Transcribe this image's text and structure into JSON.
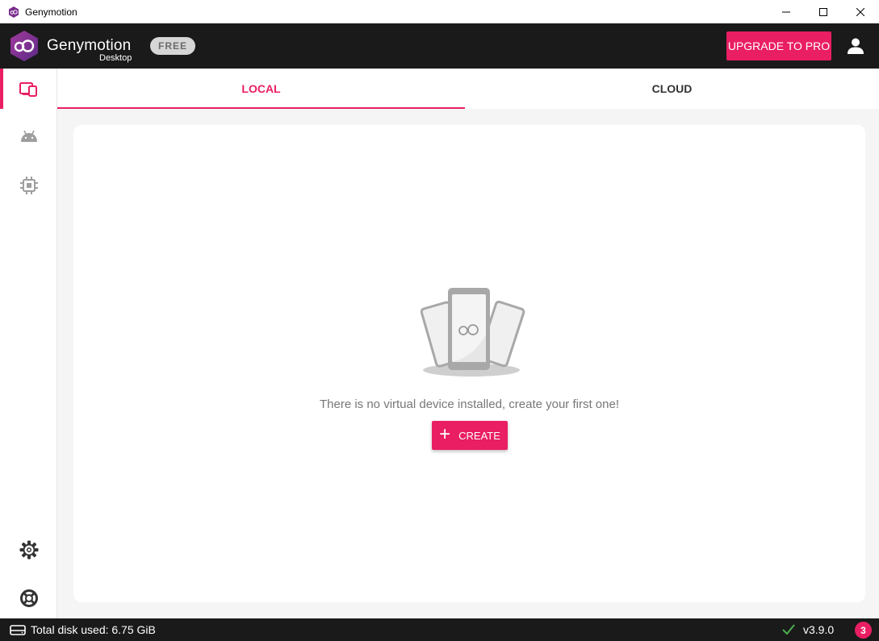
{
  "window": {
    "title": "Genymotion"
  },
  "header": {
    "brand": "Genymotion",
    "brand_sub": "Desktop",
    "plan_badge": "FREE",
    "upgrade_label": "UPGRADE TO PRO"
  },
  "tabs": [
    {
      "label": "LOCAL",
      "active": true
    },
    {
      "label": "CLOUD",
      "active": false
    }
  ],
  "sidebar": {
    "items": [
      {
        "icon": "devices-icon",
        "active": true
      },
      {
        "icon": "android-icon",
        "active": false
      },
      {
        "icon": "chip-icon",
        "active": false
      }
    ],
    "bottom_items": [
      {
        "icon": "gear-icon"
      },
      {
        "icon": "lifebuoy-icon"
      }
    ]
  },
  "main": {
    "empty_message": "There is no virtual device installed, create your first one!",
    "create_label": "CREATE",
    "illustration_icon": "phones-illustration-icon"
  },
  "statusbar": {
    "disk_label": "Total disk used: 6.75 GiB",
    "version": "v3.9.0",
    "notification_count": "3"
  },
  "colors": {
    "accent": "#e91e63",
    "header_bg": "#1a1a1a",
    "main_bg": "#f5f5f5"
  }
}
